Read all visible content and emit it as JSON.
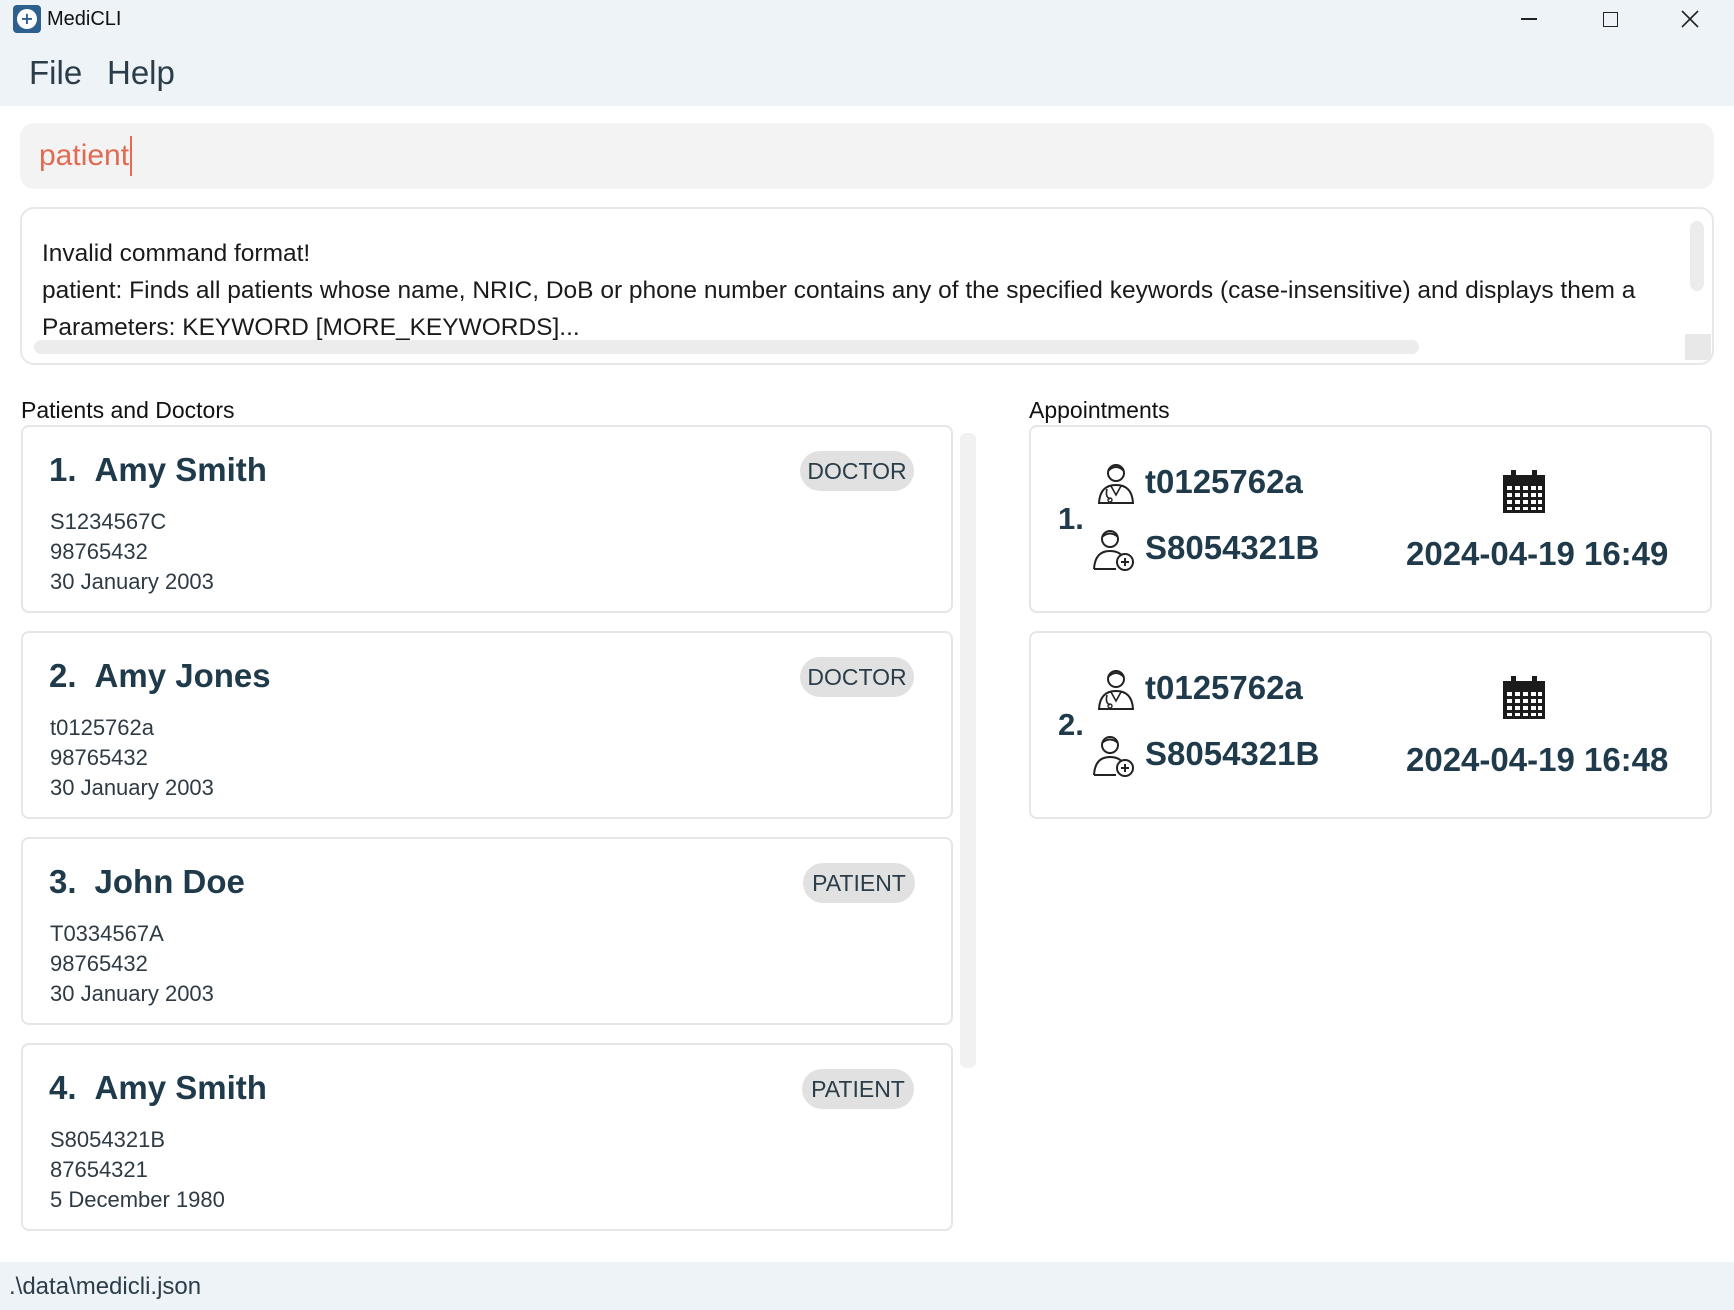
{
  "window": {
    "title": "MediCLI"
  },
  "menu": {
    "file": "File",
    "help": "Help"
  },
  "command": {
    "value": "patient"
  },
  "result": {
    "lines": [
      "Invalid command format!",
      "patient: Finds all patients whose name, NRIC, DoB or phone number contains any of the specified keywords (case-insensitive) and displays them a",
      "Parameters: KEYWORD [MORE_KEYWORDS]..."
    ]
  },
  "people": {
    "heading": "Patients and Doctors",
    "items": [
      {
        "index": "1.",
        "name": "Amy Smith",
        "role": "DOCTOR",
        "nric": "S1234567C",
        "phone": "98765432",
        "dob": "30 January 2003"
      },
      {
        "index": "2.",
        "name": "Amy Jones",
        "role": "DOCTOR",
        "nric": "t0125762a",
        "phone": "98765432",
        "dob": "30 January 2003"
      },
      {
        "index": "3.",
        "name": "John Doe",
        "role": "PATIENT",
        "nric": "T0334567A",
        "phone": "98765432",
        "dob": "30 January 2003"
      },
      {
        "index": "4.",
        "name": "Amy Smith",
        "role": "PATIENT",
        "nric": "S8054321B",
        "phone": "87654321",
        "dob": "5 December 1980"
      }
    ]
  },
  "appointments": {
    "heading": "Appointments",
    "items": [
      {
        "index": "1.",
        "doctor_id": "t0125762a",
        "patient_id": "S8054321B",
        "datetime": "2024-04-19 16:49"
      },
      {
        "index": "2.",
        "doctor_id": "t0125762a",
        "patient_id": "S8054321B",
        "datetime": "2024-04-19 16:48"
      }
    ]
  },
  "status": {
    "path": ".\\data\\medicli.json"
  },
  "icons": {
    "app": "medicli-logo-icon",
    "doctor": "doctor-icon",
    "patient": "patient-icon",
    "calendar": "calendar-icon"
  },
  "colors": {
    "command_text": "#e16a52",
    "name_text": "#1f3a4a",
    "badge_bg": "#e1e1e1",
    "chrome_bg": "#eef3f7"
  }
}
